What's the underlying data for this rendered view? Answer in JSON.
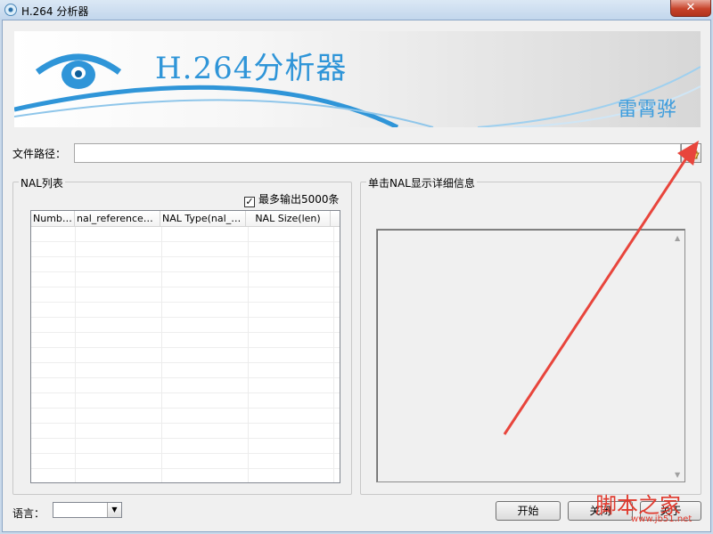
{
  "window": {
    "title": "H.264 分析器",
    "close_glyph": "✕"
  },
  "banner": {
    "title": "H.264分析器",
    "author": "雷霄骅",
    "accent_color": "#2f95d8"
  },
  "file_path": {
    "label": "文件路径：",
    "value": "",
    "browse_icon": "folder-open-icon"
  },
  "nal_list": {
    "group_title": "NAL列表",
    "max_output_checkbox": {
      "label": "最多输出5000条",
      "checked": true,
      "mark": "✓"
    },
    "columns": [
      "Number",
      "nal_reference_idc",
      "NAL Type(nal_u...",
      "NAL Size(len)"
    ],
    "rows": []
  },
  "detail": {
    "group_title": "单击NAL显示详细信息",
    "text": ""
  },
  "language": {
    "label": "语言：",
    "selected": ""
  },
  "buttons": {
    "start": "开始",
    "close": "关闭",
    "about": "关于"
  },
  "watermark": {
    "text": "脚本之家",
    "url": "www.jb51.net"
  },
  "annotation": {
    "arrow_color": "#e8453c"
  }
}
